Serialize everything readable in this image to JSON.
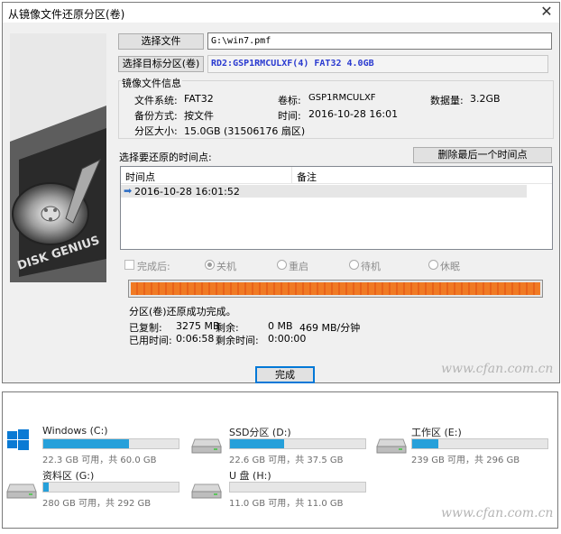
{
  "dialog": {
    "title": "从镜像文件还原分区(卷)",
    "close_glyph": "✕",
    "select_file_button": "选择文件",
    "file_path": "G:\\win7.pmf",
    "select_target_button": "选择目标分区(卷)",
    "target_partition": "RD2:GSP1RMCULXF(4) FAT32 4.0GB",
    "image_info": {
      "header": "镜像文件信息",
      "fs_label": "文件系统:",
      "fs_value": "FAT32",
      "volume_label": "卷标:",
      "volume_value": "GSP1RMCULXF",
      "data_label": "数据量:",
      "data_value": "3.2GB",
      "backup_label": "备份方式:",
      "backup_value": "按文件",
      "time_label": "时间:",
      "time_value": "2016-10-28 16:01",
      "size_label": "分区大小:",
      "size_value": "15.0GB  (31506176 扇区)"
    },
    "timepoint_header": "选择要还原的时间点:",
    "delete_last_button": "删除最后一个时间点",
    "table": {
      "columns": [
        "时间点",
        "备注"
      ],
      "rows": [
        {
          "time": "2016-10-28 16:01:52",
          "note": ""
        }
      ],
      "selected_marker": "➡"
    },
    "after_complete": {
      "label": "完成后:",
      "options": [
        "关机",
        "重启",
        "待机",
        "休眠"
      ],
      "selected": "关机"
    },
    "progress": {
      "fraction": 1.0,
      "accent": "#f07a24"
    },
    "status": "分区(卷)还原成功完成。",
    "stats": {
      "copied_label": "已复制:",
      "copied_value": "3275 MB",
      "remaining_label": "剩余:",
      "remaining_value": "0 MB",
      "speed_value": "469 MB/分钟",
      "elapsed_label": "已用时间:",
      "elapsed_value": "0:06:58",
      "eta_label": "剩余时间:",
      "eta_value": "0:00:00"
    },
    "finish_button": "完成",
    "art_text": "DISK GENIUS",
    "watermark": "www.cfan.com.cn"
  },
  "explorer": {
    "drives": [
      {
        "name": "Windows (C:)",
        "info": "22.3 GB 可用，共 60.0 GB",
        "used_fraction": 0.63,
        "icon": "windows-drive-icon"
      },
      {
        "name": "SSD分区 (D:)",
        "info": "22.6 GB 可用，共 37.5 GB",
        "used_fraction": 0.4,
        "icon": "hdd-icon"
      },
      {
        "name": "工作区 (E:)",
        "info": "239 GB 可用，共 296 GB",
        "used_fraction": 0.19,
        "icon": "hdd-icon"
      },
      {
        "name": "资料区 (G:)",
        "info": "280 GB 可用，共 292 GB",
        "used_fraction": 0.04,
        "icon": "hdd-icon"
      },
      {
        "name": "U 盘 (H:)",
        "info": "11.0 GB 可用，共 11.0 GB",
        "used_fraction": 0.0,
        "icon": "hdd-icon"
      }
    ],
    "bar_color": "#26a0da",
    "watermark": "www.cfan.com.cn"
  }
}
